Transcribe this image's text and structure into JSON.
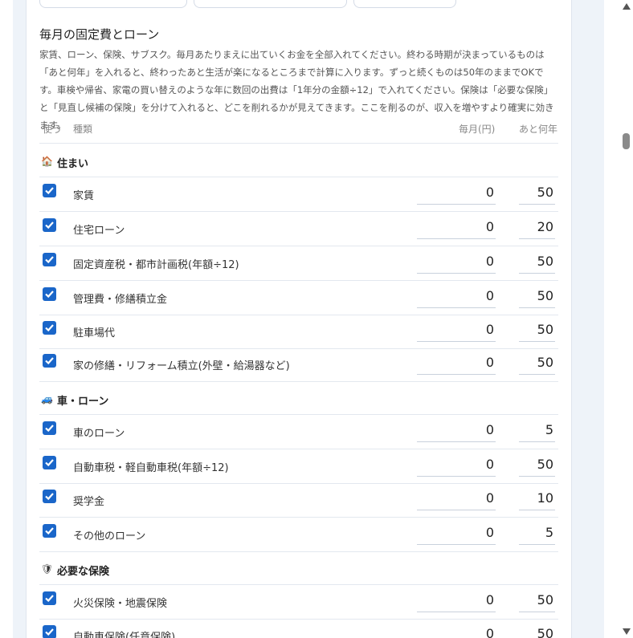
{
  "section": {
    "title": "毎月の固定費とローン",
    "description": "家賃、ローン、保険、サブスク。毎月あたりまえに出ていくお金を全部入れてください。終わる時期が決まっているものは「あと何年」を入れると、終わったあと生活が楽になるところまで計算に入ります。ずっと続くものは50年のままでOKです。車検や帰省、家電の買い替えのような年に数回の出費は「1年分の金額÷12」で入れてください。保険は「必要な保険」と「見直し候補の保険」を分けて入れると、どこを削れるかが見えてきます。ここを削るのが、収入を増やすより確実に効きます。"
  },
  "columns": {
    "use": "使う",
    "type": "種類",
    "monthly": "毎月(円)",
    "years": "あと何年"
  },
  "categories": [
    {
      "icon": "🏠",
      "label": "住まい"
    },
    {
      "icon": "🚙",
      "label": "車・ローン"
    },
    {
      "icon": "🛡",
      "label": "必要な保険"
    }
  ],
  "rows": [
    {
      "label": "家賃",
      "monthly": "0",
      "years": "50",
      "checked": true
    },
    {
      "label": "住宅ローン",
      "monthly": "0",
      "years": "20",
      "checked": true
    },
    {
      "label": "固定資産税・都市計画税(年額÷12)",
      "monthly": "0",
      "years": "50",
      "checked": true
    },
    {
      "label": "管理費・修繕積立金",
      "monthly": "0",
      "years": "50",
      "checked": true
    },
    {
      "label": "駐車場代",
      "monthly": "0",
      "years": "50",
      "checked": true
    },
    {
      "label": "家の修繕・リフォーム積立(外壁・給湯器など)",
      "monthly": "0",
      "years": "50",
      "checked": true
    },
    {
      "label": "車のローン",
      "monthly": "0",
      "years": "5",
      "checked": true
    },
    {
      "label": "自動車税・軽自動車税(年額÷12)",
      "monthly": "0",
      "years": "50",
      "checked": true
    },
    {
      "label": "奨学金",
      "monthly": "0",
      "years": "10",
      "checked": true
    },
    {
      "label": "その他のローン",
      "monthly": "0",
      "years": "5",
      "checked": true
    },
    {
      "label": "火災保険・地震保険",
      "monthly": "0",
      "years": "50",
      "checked": true
    },
    {
      "label": "自動車保険(任意保険)",
      "monthly": "0",
      "years": "50",
      "checked": true
    }
  ],
  "colors": {
    "checkbox": "#1a66c9",
    "page_bg": "#eef3f9"
  }
}
